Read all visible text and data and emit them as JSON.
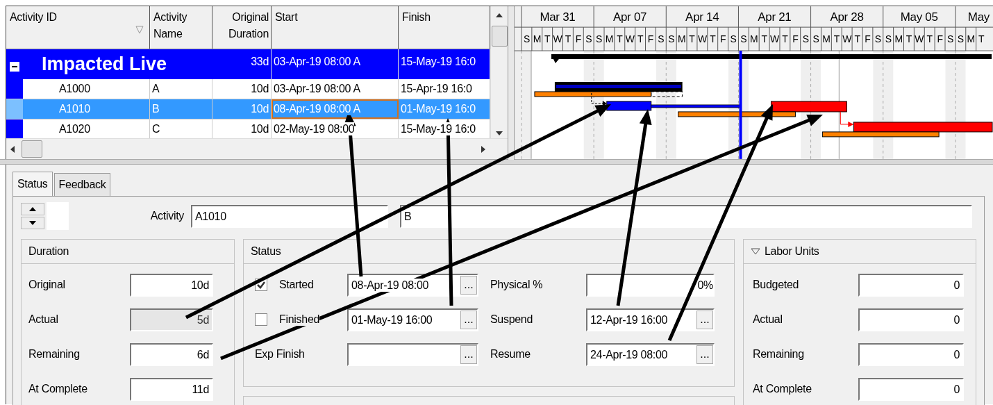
{
  "table": {
    "columns": [
      {
        "label": "Activity ID"
      },
      {
        "label": "Activity Name"
      },
      {
        "label": "Original Duration"
      },
      {
        "label": "Start"
      },
      {
        "label": "Finish"
      }
    ],
    "rows": [
      {
        "kind": "group",
        "id": "Impacted Live",
        "original_duration": "33d",
        "start": "03-Apr-19 08:00 A",
        "finish": "15-May-19 16:0",
        "expanded": true,
        "selected": false
      },
      {
        "kind": "activity",
        "id": "A1000",
        "name": "A",
        "original_duration": "10d",
        "start": "03-Apr-19 08:00 A",
        "finish": "15-Apr-19 16:0",
        "selected": false
      },
      {
        "kind": "activity",
        "id": "A1010",
        "name": "B",
        "original_duration": "10d",
        "start": "08-Apr-19 08:00 A",
        "finish": "01-May-19 16:0",
        "selected": true
      },
      {
        "kind": "activity",
        "id": "A1020",
        "name": "C",
        "original_duration": "10d",
        "start": "02-May-19 08:00",
        "finish": "15-May-19 16:0",
        "selected": false
      }
    ]
  },
  "gantt": {
    "weeks": [
      "Mar 31",
      "Apr 07",
      "Apr 14",
      "Apr 21",
      "Apr 28",
      "May 05",
      "May"
    ],
    "days": [
      "S",
      "M",
      "T",
      "W",
      "T",
      "F",
      "S",
      "S",
      "M",
      "T",
      "W",
      "T",
      "F",
      "S",
      "S",
      "M",
      "T",
      "W",
      "T",
      "F",
      "S",
      "S",
      "M",
      "T",
      "W",
      "T",
      "F",
      "S",
      "S",
      "M",
      "T",
      "W",
      "T",
      "F",
      "S",
      "S",
      "M",
      "T",
      "W",
      "T",
      "F",
      "S",
      "S",
      "M",
      "T"
    ]
  },
  "tabs": [
    {
      "label": "Status",
      "selected": true
    },
    {
      "label": "Feedback",
      "selected": false
    }
  ],
  "activity": {
    "label": "Activity",
    "id": "A1010",
    "name": "B"
  },
  "duration": {
    "title": "Duration",
    "fields": [
      {
        "label": "Original",
        "value": "10d",
        "disabled": false
      },
      {
        "label": "Actual",
        "value": "5d",
        "disabled": true
      },
      {
        "label": "Remaining",
        "value": "6d",
        "disabled": false
      },
      {
        "label": "At Complete",
        "value": "11d",
        "disabled": false
      }
    ]
  },
  "status": {
    "title": "Status",
    "left": [
      {
        "kind": "checkbox",
        "label": "Started",
        "checked": true,
        "value": "08-Apr-19 08:00",
        "button": "..."
      },
      {
        "kind": "checkbox",
        "label": "Finished",
        "checked": false,
        "value": "01-May-19 16:00",
        "button": "..."
      },
      {
        "kind": "plain",
        "label": "Exp Finish",
        "button": "..."
      }
    ],
    "right": [
      {
        "label": "Physical %",
        "value": "0%"
      },
      {
        "label": "Suspend",
        "value": "12-Apr-19 16:00",
        "button": "..."
      },
      {
        "label": "Resume",
        "value": "24-Apr-19 08:00",
        "button": "..."
      }
    ]
  },
  "labor_units": {
    "title": "Labor Units",
    "expanded": true,
    "fields": [
      {
        "label": "Budgeted",
        "value": "0"
      },
      {
        "label": "Actual",
        "value": "0"
      },
      {
        "label": "Remaining",
        "value": "0"
      },
      {
        "label": "At Complete",
        "value": "0"
      }
    ]
  }
}
